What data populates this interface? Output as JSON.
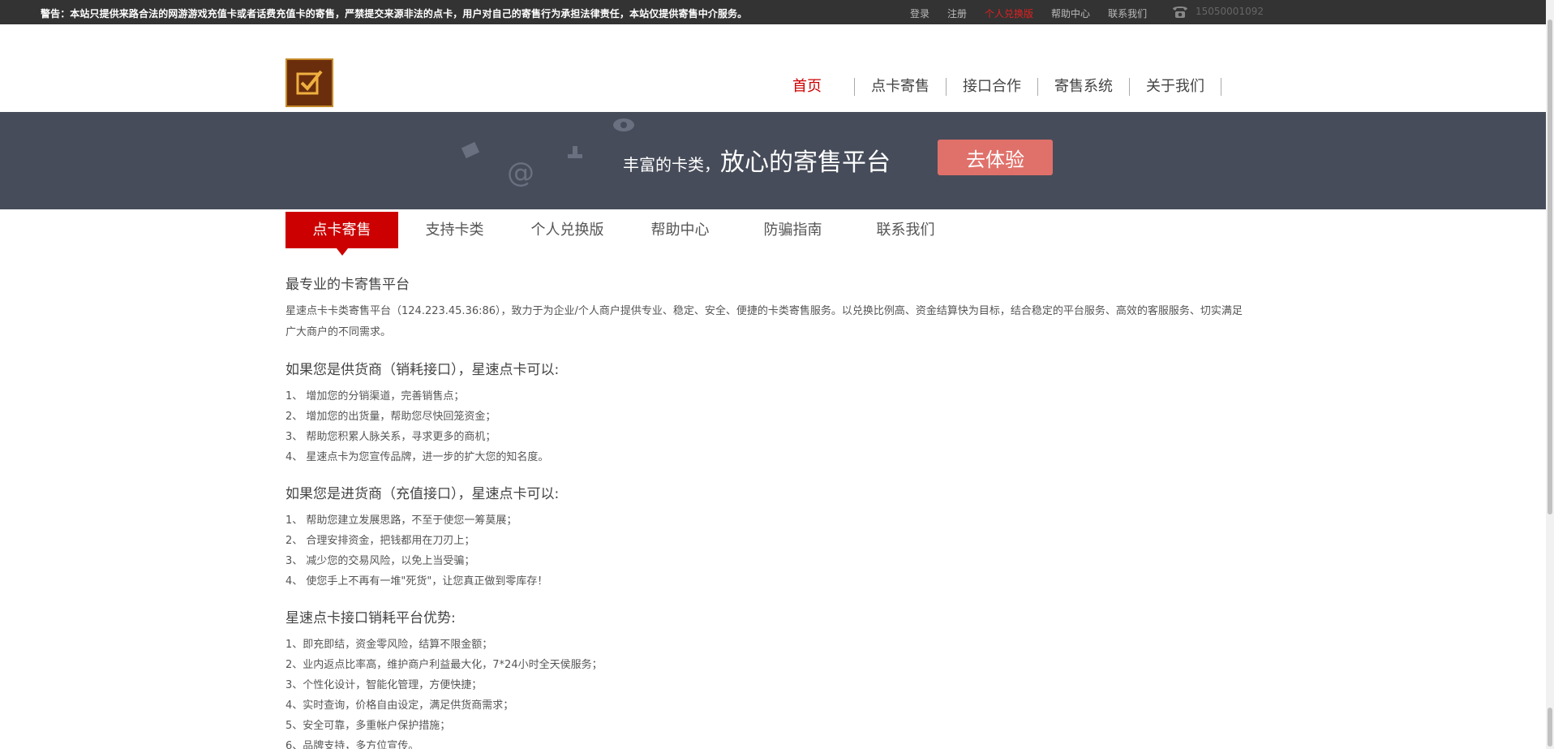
{
  "topbar": {
    "warning": "警告：本站只提供来路合法的网游游戏充值卡或者话费充值卡的寄售，严禁提交来源非法的点卡，用户对自己的寄售行为承担法律责任，本站仅提供寄售中介服务。",
    "links": [
      "登录",
      "注册",
      "个人兑换版",
      "帮助中心",
      "联系我们"
    ],
    "phone": "15050001092"
  },
  "nav": {
    "items": [
      "首页",
      "点卡寄售",
      "接口合作",
      "寄售系统",
      "关于我们"
    ]
  },
  "banner": {
    "slogan_small": "丰富的卡类，",
    "slogan_big": "放心的寄售平台",
    "cta": "去体验"
  },
  "tabs": [
    "点卡寄售",
    "支持卡类",
    "个人兑换版",
    "帮助中心",
    "防骗指南",
    "联系我们"
  ],
  "content": {
    "title": "最专业的卡寄售平台",
    "intro": "星速点卡卡类寄售平台（124.223.45.36:86），致力于为企业/个人商户提供专业、稳定、安全、便捷的卡类寄售服务。以兑换比例高、资金结算快为目标，结合稳定的平台服务、高效的客服服务、切实满足广大商户的不同需求。",
    "sections": [
      {
        "title": "如果您是供货商（销耗接口），星速点卡可以:",
        "items": [
          "1、 增加您的分销渠道，完善销售点；",
          "2、 增加您的出货量，帮助您尽快回笼资金；",
          "3、 帮助您积累人脉关系，寻求更多的商机；",
          "4、 星速点卡为您宣传品牌，进一步的扩大您的知名度。"
        ]
      },
      {
        "title": "如果您是进货商（充值接口），星速点卡可以:",
        "items": [
          "1、 帮助您建立发展思路，不至于使您一筹莫展；",
          "2、 合理安排资金，把钱都用在刀刃上；",
          "3、 减少您的交易风险，以免上当受骗；",
          "4、 使您手上不再有一堆\"死货\"，让您真正做到零库存！"
        ]
      },
      {
        "title": "星速点卡接口销耗平台优势:",
        "items": [
          "1、即充即结，资金零风险，结算不限金额；",
          "2、业内返点比率高，维护商户利益最大化，7*24小时全天侯服务；",
          "3、个性化设计，智能化管理，方便快捷；",
          "4、实时查询，价格自由设定，满足供货商需求；",
          "5、安全可靠，多重帐户保护措施；",
          "6、品牌支持，多方位宣传。"
        ]
      }
    ]
  }
}
